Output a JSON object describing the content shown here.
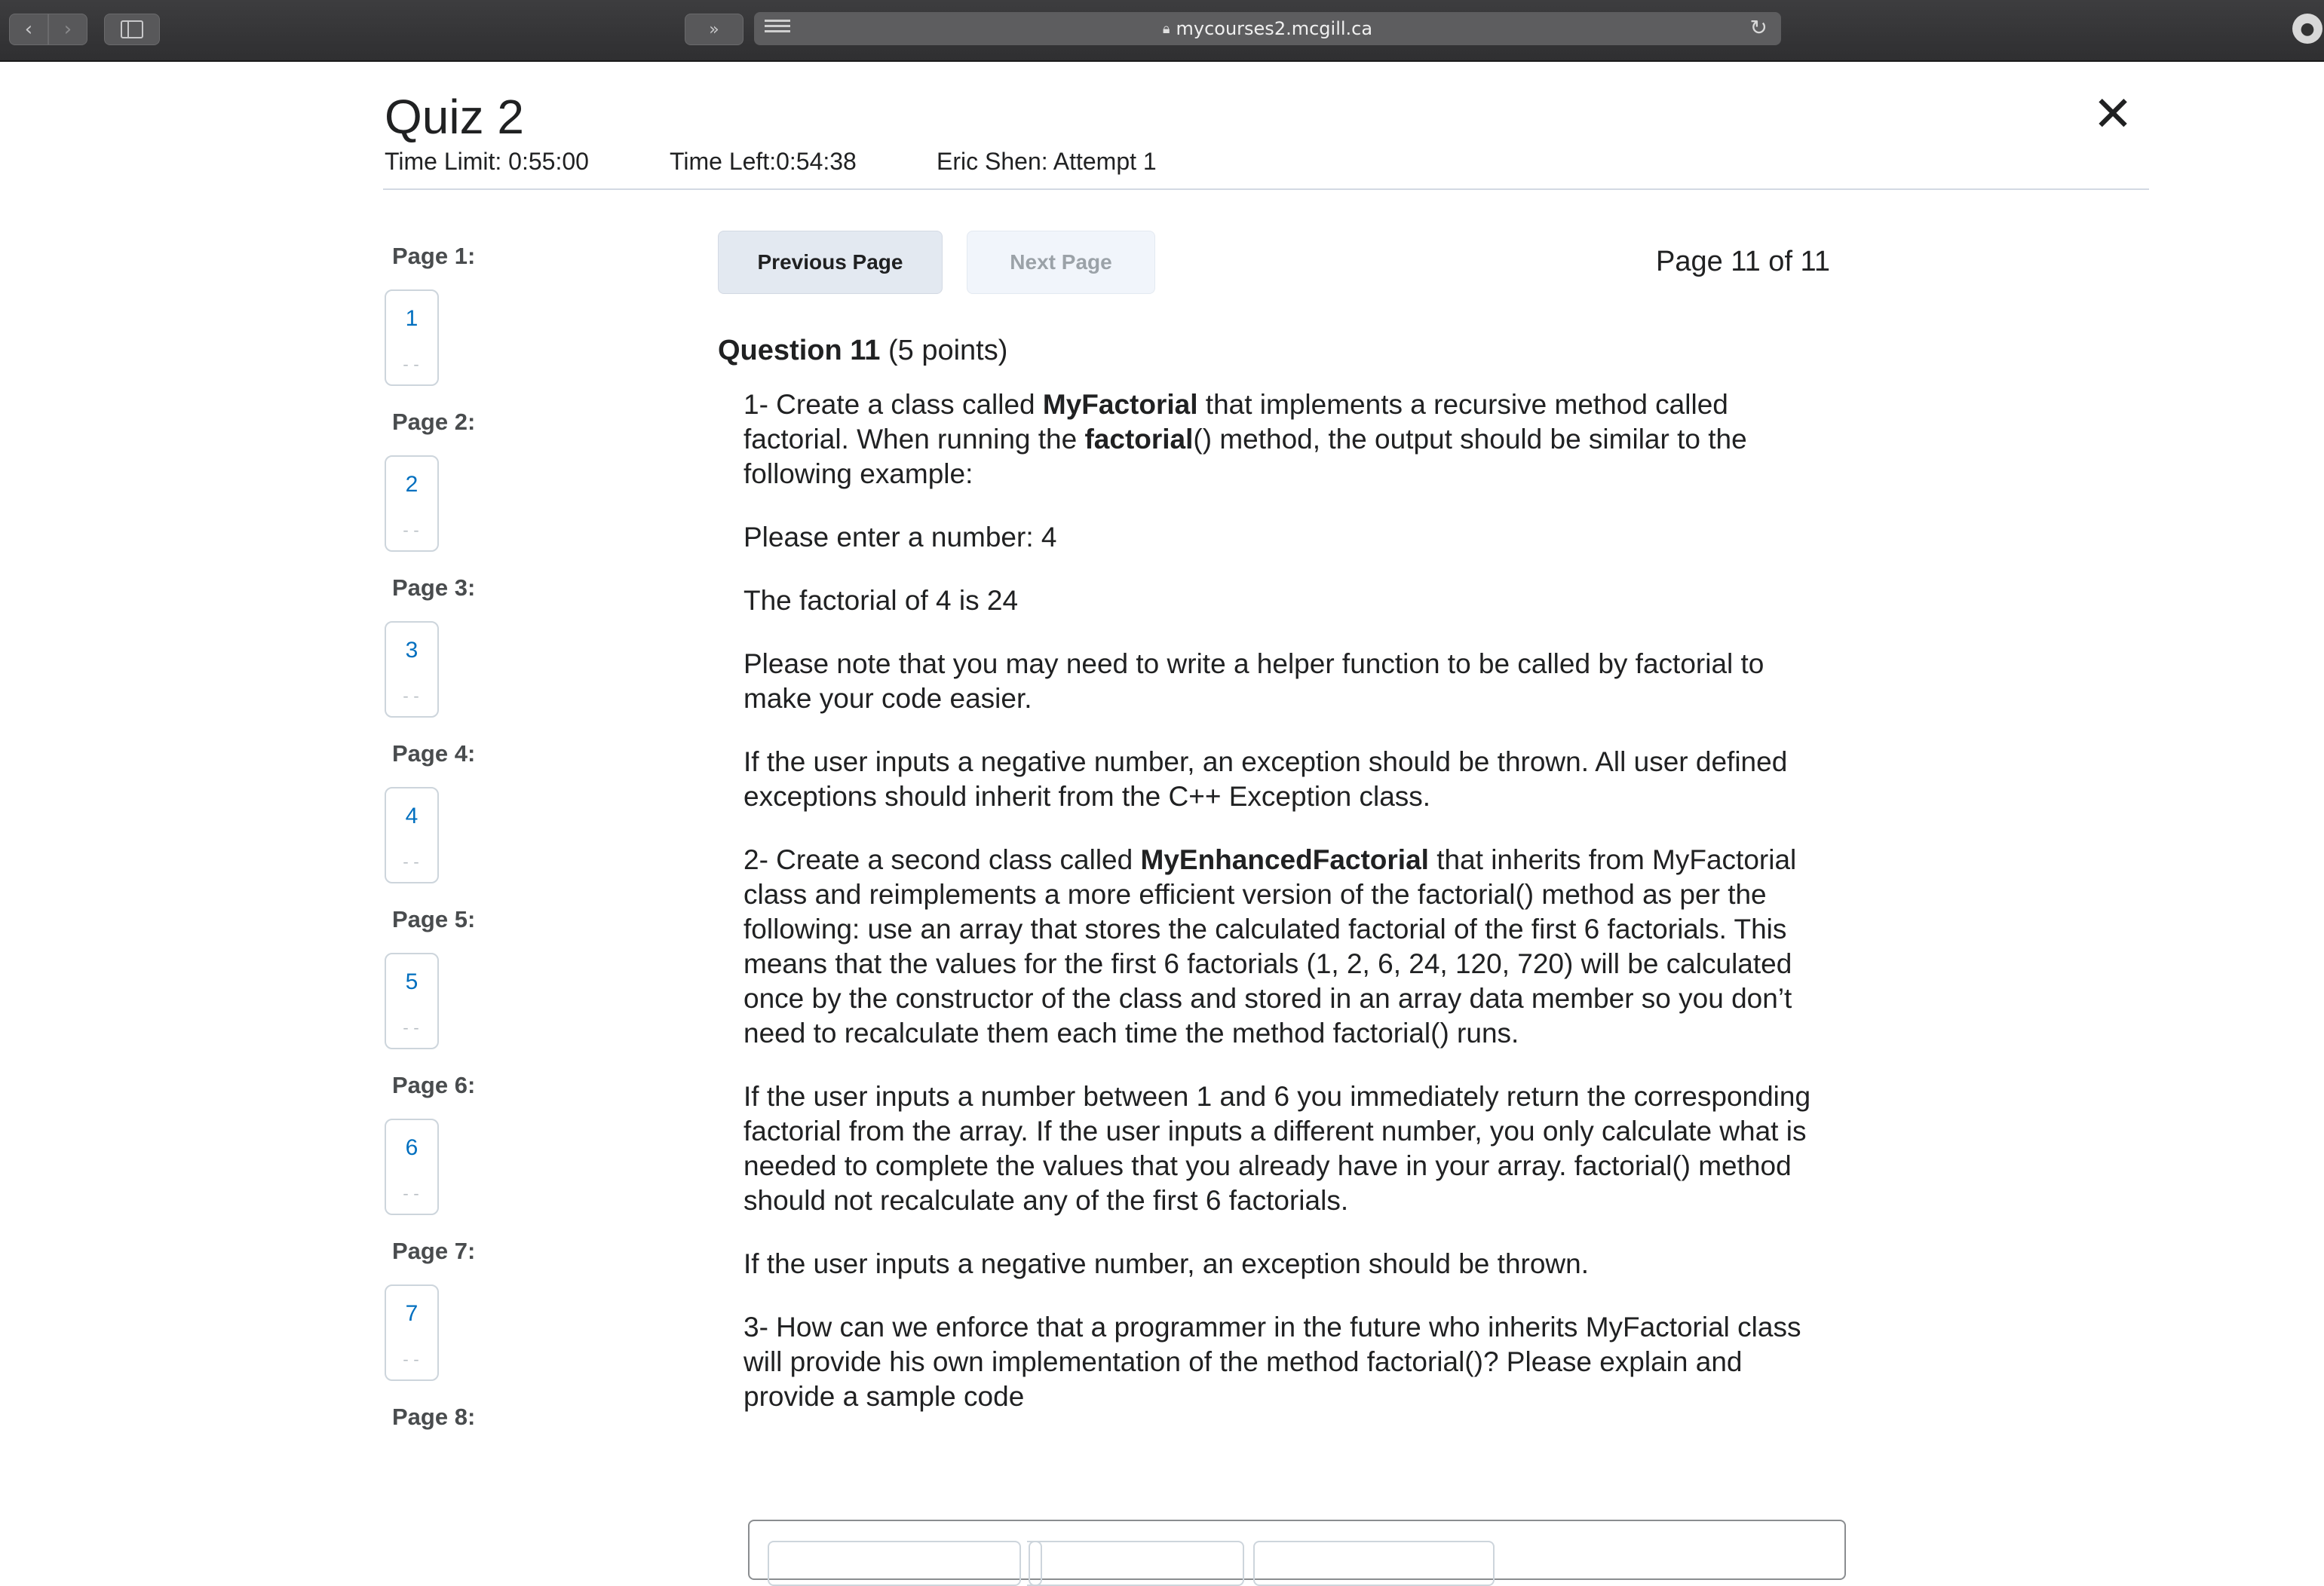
{
  "browser": {
    "url": "mycourses2.mcgill.ca",
    "icons": {
      "back": "back-arrow-icon",
      "forward": "forward-arrow-icon",
      "sidebar": "sidebar-icon",
      "extension": "extension-icon",
      "reader": "reader-icon",
      "lock": "lock-icon",
      "reload": "reload-icon"
    }
  },
  "quiz": {
    "title": "Quiz 2",
    "time_limit": "Time Limit: 0:55:00",
    "time_left": "Time Left:0:54:38",
    "attempt": "Eric Shen: Attempt 1",
    "close_glyph": "✕"
  },
  "page_nav": [
    {
      "label": "Page 1:",
      "num": "1",
      "status": "--"
    },
    {
      "label": "Page 2:",
      "num": "2",
      "status": "--"
    },
    {
      "label": "Page 3:",
      "num": "3",
      "status": "--"
    },
    {
      "label": "Page 4:",
      "num": "4",
      "status": "--"
    },
    {
      "label": "Page 5:",
      "num": "5",
      "status": "--"
    },
    {
      "label": "Page 6:",
      "num": "6",
      "status": "--"
    },
    {
      "label": "Page 7:",
      "num": "7",
      "status": "--"
    },
    {
      "label": "Page 8:"
    }
  ],
  "toolbar": {
    "prev_label": "Previous Page",
    "next_label": "Next Page",
    "page_indicator": "Page 11 of 11"
  },
  "question": {
    "number_label": "Question 11",
    "points": "(5 points)",
    "p1_a": "1- Create a class called ",
    "p1_b": "MyFactorial",
    "p1_c": " that implements a recursive method called factorial. When running the ",
    "p1_d": "factorial",
    "p1_e": "() method, the output should be similar to the following example:",
    "p2": "Please enter a number: 4",
    "p3": "The factorial of 4 is 24",
    "p4": "Please note that you may need to write a helper function to be called by factorial to make your code easier.",
    "p5": "If the user inputs a negative number, an exception should be thrown.  All user defined exceptions should inherit from the C++ Exception class.",
    "p6_a": "2- Create a second class called ",
    "p6_b": "MyEnhancedFactorial",
    "p6_c": " that inherits from MyFactorial class and reimplements a more efficient version of the factorial() method as per the following: use an array that stores the calculated factorial of the first 6 factorials. This means that the values for the first 6 factorials (1, 2, 6, 24, 120, 720) will be calculated once by the constructor of the class and stored in an array data member so you don’t need to recalculate them each time the method factorial() runs.",
    "p7": "If the user inputs a number between 1 and 6 you immediately return the corresponding factorial from the array. If the user inputs a different number, you only calculate what is needed to complete the values that you already have in your array. factorial() method should not recalculate any of the first 6 factorials.",
    "p8": "If the user inputs a negative number, an exception should be thrown.",
    "p9": "3- How can we enforce that a programmer in the future who inherits MyFactorial class will  provide his own implementation of the method factorial()? Please explain and provide a sample code"
  }
}
